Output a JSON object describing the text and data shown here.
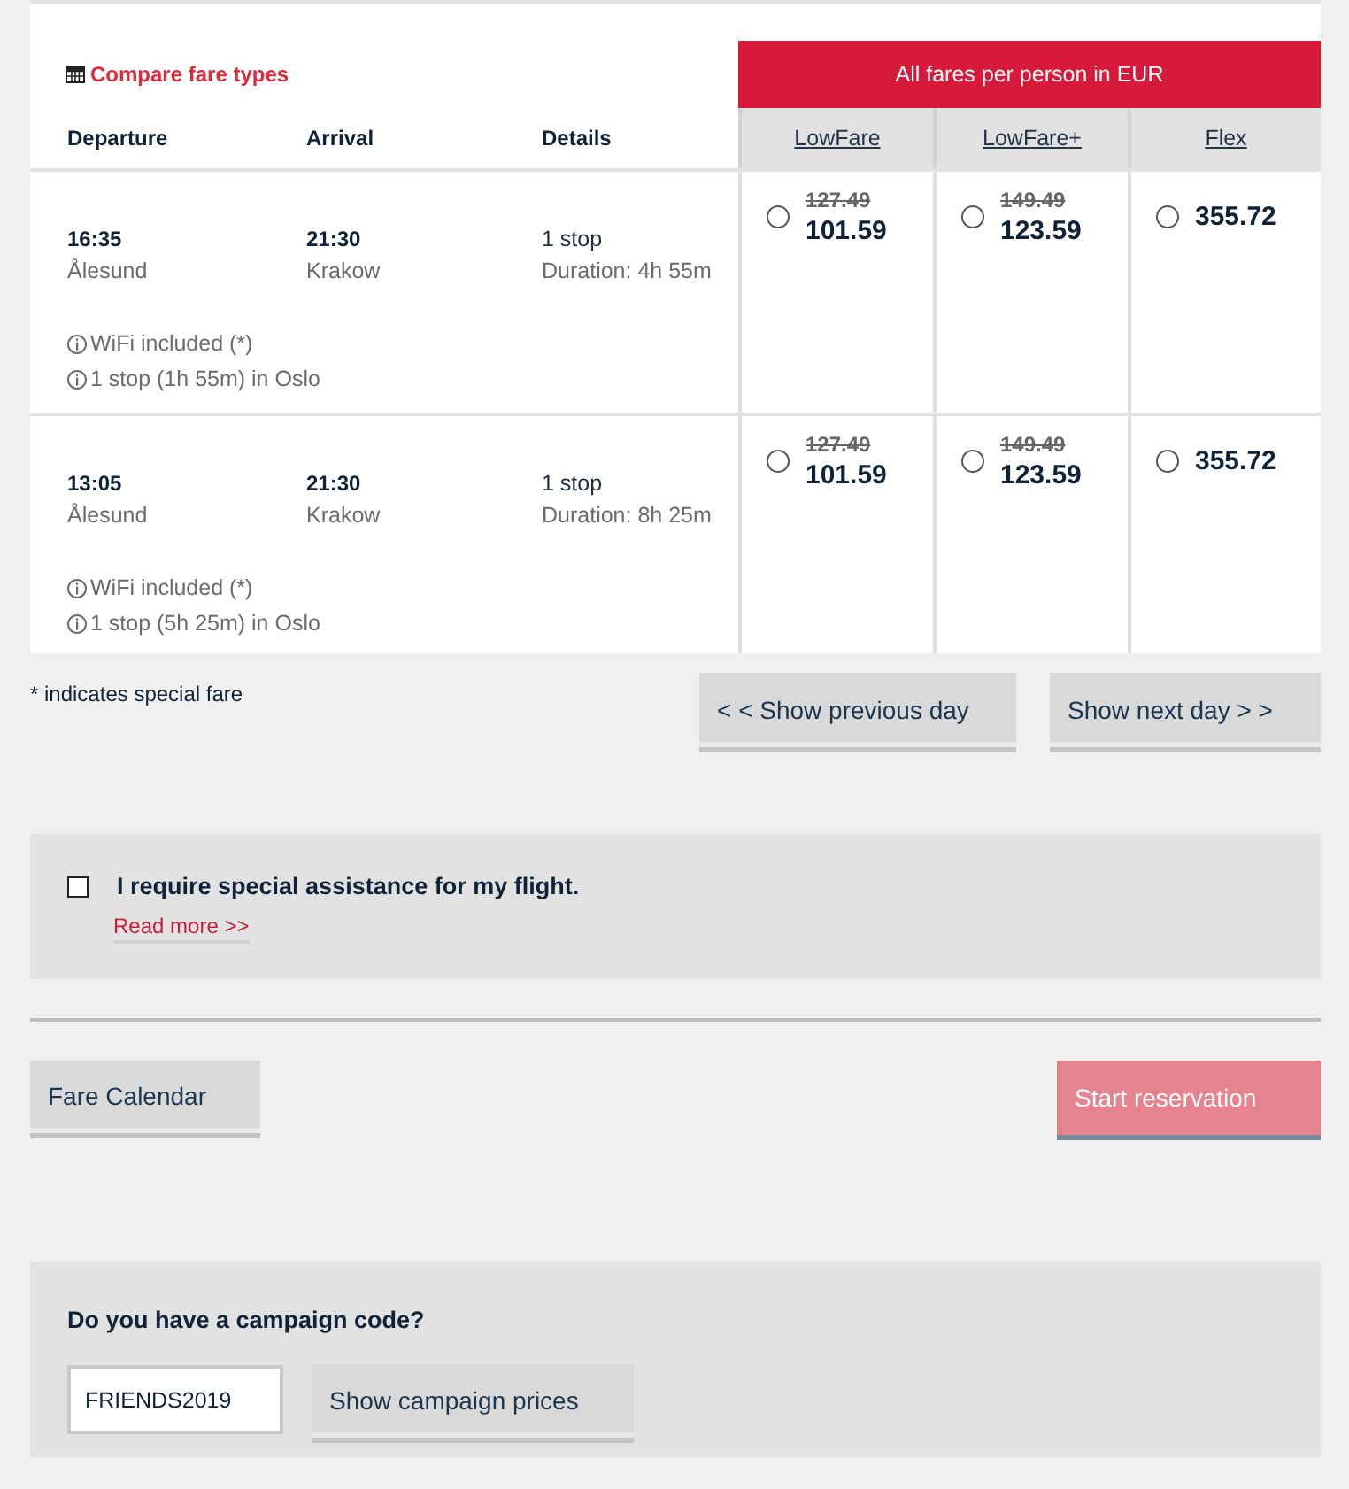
{
  "fare_table": {
    "compare_link": "Compare fare types",
    "currency_banner": "All fares per person in EUR",
    "columns": [
      "Departure",
      "Arrival",
      "Details"
    ],
    "fare_types": [
      "LowFare",
      "LowFare+",
      "Flex"
    ],
    "flights": [
      {
        "departure_time": "16:35",
        "departure_city": "Ålesund",
        "arrival_time": "21:30",
        "arrival_city": "Krakow",
        "stops": "1 stop",
        "duration": "Duration: 4h 55m",
        "notes": [
          "WiFi included (*)",
          "1 stop (1h 55m) in Oslo"
        ],
        "fares": [
          {
            "original": "127.49",
            "price": "101.59",
            "selected": false
          },
          {
            "original": "149.49",
            "price": "123.59",
            "selected": false
          },
          {
            "price": "355.72",
            "selected": false
          }
        ]
      },
      {
        "departure_time": "13:05",
        "departure_city": "Ålesund",
        "arrival_time": "21:30",
        "arrival_city": "Krakow",
        "stops": "1 stop",
        "duration": "Duration: 8h 25m",
        "notes": [
          "WiFi included (*)",
          "1 stop (5h 25m) in Oslo"
        ],
        "fares": [
          {
            "original": "127.49",
            "price": "101.59",
            "selected": false
          },
          {
            "original": "149.49",
            "price": "123.59",
            "selected": false
          },
          {
            "price": "355.72",
            "selected": false
          }
        ]
      }
    ]
  },
  "footnote": "* indicates special fare",
  "day_nav": [
    "< < Show previous day",
    "Show next day > >"
  ],
  "assistance": {
    "label": "I require special assistance for my flight.",
    "checked": false,
    "link": "Read more >>"
  },
  "actions": [
    {
      "label": "Fare Calendar",
      "kind": "secondary",
      "disabled": false
    },
    {
      "label": "Start reservation",
      "kind": "primary",
      "disabled": true
    }
  ],
  "campaign": {
    "heading": "Do you have a campaign code?",
    "value": "FRIENDS2019",
    "button": "Show campaign prices"
  }
}
